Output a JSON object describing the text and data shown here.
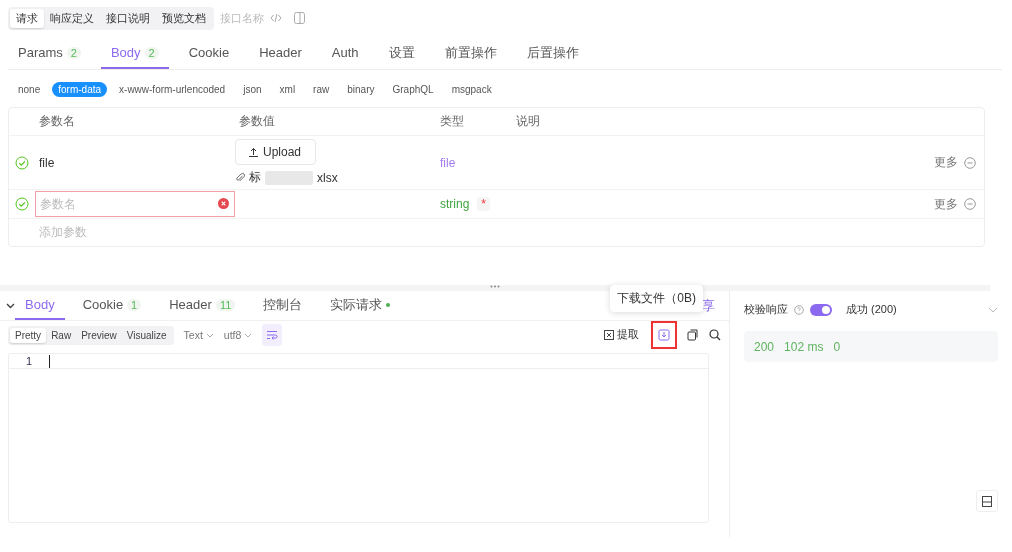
{
  "top_tabs": [
    {
      "label": "请求",
      "selected": true
    },
    {
      "label": "响应定义",
      "selected": false
    },
    {
      "label": "接口说明",
      "selected": false
    },
    {
      "label": "预览文档",
      "selected": false
    }
  ],
  "name_placeholder": "接口名称",
  "request_tabs": [
    {
      "label": "Params",
      "count": "2",
      "selected": false
    },
    {
      "label": "Body",
      "count": "2",
      "selected": true
    },
    {
      "label": "Cookie",
      "selected": false
    },
    {
      "label": "Header",
      "selected": false
    },
    {
      "label": "Auth",
      "selected": false
    },
    {
      "label": "设置",
      "selected": false
    },
    {
      "label": "前置操作",
      "selected": false
    },
    {
      "label": "后置操作",
      "selected": false
    }
  ],
  "body_types": [
    {
      "label": "none",
      "selected": false
    },
    {
      "label": "form-data",
      "selected": true
    },
    {
      "label": "x-www-form-urlencoded",
      "selected": false
    },
    {
      "label": "json",
      "selected": false
    },
    {
      "label": "xml",
      "selected": false
    },
    {
      "label": "raw",
      "selected": false
    },
    {
      "label": "binary",
      "selected": false
    },
    {
      "label": "GraphQL",
      "selected": false
    },
    {
      "label": "msgpack",
      "selected": false
    }
  ],
  "params_table": {
    "columns": [
      "参数名",
      "参数值",
      "类型",
      "说明"
    ],
    "rows": [
      {
        "kind": "file",
        "enabled": true,
        "name": "file",
        "upload_label": "Upload",
        "file_name_start": "标",
        "file_name_end": "xlsx",
        "type": "file",
        "more": "更多"
      },
      {
        "kind": "input",
        "enabled": true,
        "placeholder": "参数名",
        "error": true,
        "type": "string",
        "required_mark": "*",
        "more": "更多"
      }
    ],
    "add_label": "添加参数"
  },
  "response": {
    "tabs": [
      {
        "label": "Body",
        "selected": true
      },
      {
        "label": "Cookie",
        "count": "1",
        "selected": false
      },
      {
        "label": "Header",
        "count": "11",
        "selected": false
      },
      {
        "label": "控制台",
        "selected": false
      },
      {
        "label": "实际请求",
        "dot": true,
        "selected": false
      }
    ],
    "share_partial": "享",
    "tooltip": "下载文件（0B)",
    "view_modes": [
      {
        "label": "Pretty",
        "selected": true
      },
      {
        "label": "Raw",
        "selected": false
      },
      {
        "label": "Preview",
        "selected": false
      },
      {
        "label": "Visualize",
        "selected": false
      }
    ],
    "format": "Text",
    "encoding": "utf8",
    "extract_label": "提取",
    "line_numbers": [
      "1"
    ]
  },
  "validation": {
    "label": "校验响应",
    "on": true,
    "result": "成功 (200)",
    "status": "200",
    "time": "102 ms",
    "size": "0"
  }
}
